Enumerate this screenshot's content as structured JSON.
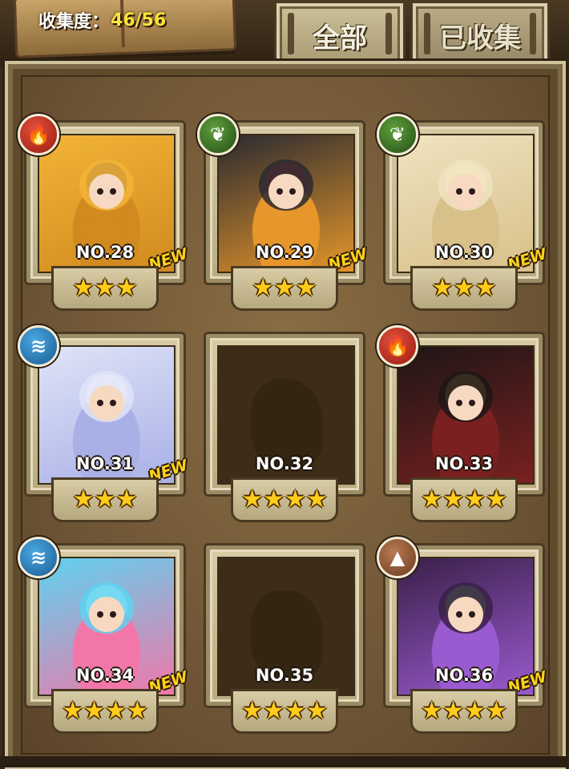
{
  "header": {
    "collect_label": "收集度：",
    "collect_value": "46/56",
    "tabs": [
      {
        "label": "全部",
        "active": true
      },
      {
        "label": "已收集",
        "active": false
      }
    ]
  },
  "cards": [
    {
      "num": "NO.28",
      "element": "fire-icon",
      "stars": 3,
      "is_new": true,
      "locked": false,
      "palette": [
        "#f2b437",
        "#d08a1f",
        "#4a3a3a"
      ]
    },
    {
      "num": "NO.29",
      "element": "leaf-icon",
      "stars": 3,
      "is_new": true,
      "locked": false,
      "palette": [
        "#2a2a30",
        "#e6962a",
        "#c22e2e"
      ]
    },
    {
      "num": "NO.30",
      "element": "leaf-icon",
      "stars": 3,
      "is_new": true,
      "locked": false,
      "palette": [
        "#efe3c0",
        "#d8c08a",
        "#fff6c0"
      ]
    },
    {
      "num": "NO.31",
      "element": "water-icon",
      "stars": 3,
      "is_new": true,
      "locked": false,
      "palette": [
        "#dfe4f7",
        "#a8b0e6",
        "#ffffff"
      ]
    },
    {
      "num": "NO.32",
      "element": "",
      "stars": 4,
      "is_new": false,
      "locked": true,
      "palette": []
    },
    {
      "num": "NO.33",
      "element": "fire-icon",
      "stars": 4,
      "is_new": false,
      "locked": false,
      "palette": [
        "#1e1616",
        "#7a2020",
        "#c8a050"
      ]
    },
    {
      "num": "NO.34",
      "element": "water-icon",
      "stars": 4,
      "is_new": true,
      "locked": false,
      "palette": [
        "#5ed2f0",
        "#f277a8",
        "#ffffff"
      ]
    },
    {
      "num": "NO.35",
      "element": "",
      "stars": 4,
      "is_new": false,
      "locked": true,
      "palette": []
    },
    {
      "num": "NO.36",
      "element": "earth-icon",
      "stars": 4,
      "is_new": true,
      "locked": false,
      "palette": [
        "#3a2048",
        "#9a5ad0",
        "#6ad04a"
      ]
    }
  ],
  "new_label": "NEW",
  "element_glyphs": {
    "fire-icon": "🔥",
    "leaf-icon": "❦",
    "water-icon": "≋",
    "earth-icon": "▲"
  }
}
